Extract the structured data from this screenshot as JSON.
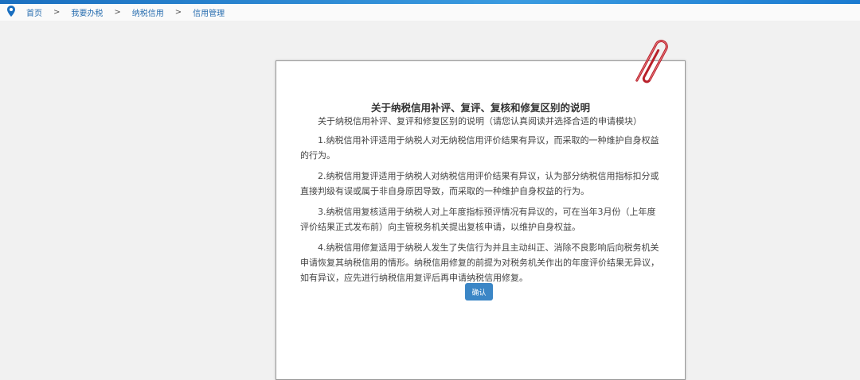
{
  "breadcrumb": [
    "首页",
    "我要办税",
    "纳税信用",
    "信用管理"
  ],
  "breadcrumb_separator": ">",
  "notice": {
    "title": "关于纳税信用补评、复评、复核和修复区别的说明",
    "subtitle": "关于纳税信用补评、复评和修复区别的说明（请您认真阅读并选择合适的申请模块）",
    "paragraphs": [
      "1.纳税信用补评适用于纳税人对无纳税信用评价结果有异议，而采取的一种维护自身权益的行为。",
      "2.纳税信用复评适用于纳税人对纳税信用评价结果有异议，认为部分纳税信用指标扣分或直接判级有误或属于非自身原因导致，而采取的一种维护自身权益的行为。",
      "3.纳税信用复核适用于纳税人对上年度指标预评情况有异议的，可在当年3月份（上年度评价结果正式发布前）向主管税务机关提出复核申请，以维护自身权益。",
      "4.纳税信用修复适用于纳税人发生了失信行为并且主动纠正、消除不良影响后向税务机关申请恢复其纳税信用的情形。纳税信用修复的前提为对税务机关作出的年度评价结果无异议，如有异议，应先进行纳税信用复评后再申请纳税信用修复。"
    ],
    "confirm_label": "确认"
  }
}
